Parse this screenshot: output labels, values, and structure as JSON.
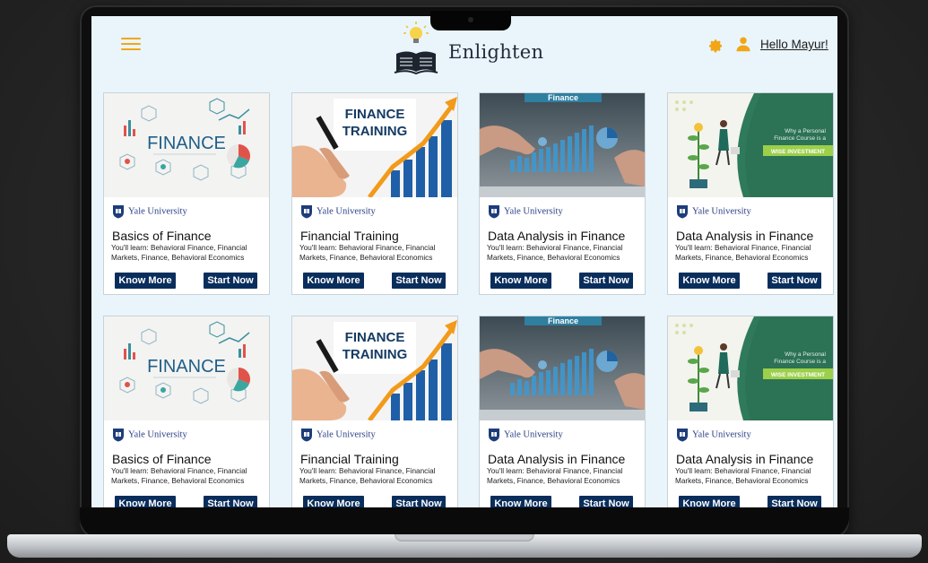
{
  "app": {
    "brand": "Enlighten",
    "greeting": "Hello Mayur!"
  },
  "thumbs": {
    "finance": {
      "word": "FINANCE"
    },
    "training": {
      "line1": "FINANCE",
      "line2": "TRAINING"
    },
    "data": {
      "tag": "Finance"
    },
    "invest": {
      "line1": "Why a Personal",
      "line2": "Finance Course is a",
      "banner": "WISE INVESTMENT"
    }
  },
  "courses": [
    {
      "thumb": "finance",
      "university": "Yale University",
      "title": "Basics of Finance",
      "learn": "You'll learn: Behavioral Finance, Financial Markets, Finance, Behavioral Economics",
      "know_more": "Know More",
      "start_now": "Start Now"
    },
    {
      "thumb": "training",
      "university": "Yale University",
      "title": "Financial Training",
      "learn": "You'll learn: Behavioral Finance, Financial Markets, Finance, Behavioral Economics",
      "know_more": "Know More",
      "start_now": "Start Now"
    },
    {
      "thumb": "data",
      "university": "Yale University",
      "title": "Data Analysis in Finance",
      "learn": "You'll learn: Behavioral Finance, Financial Markets, Finance, Behavioral Economics",
      "know_more": "Know More",
      "start_now": "Start Now"
    },
    {
      "thumb": "invest",
      "university": "Yale University",
      "title": "Data Analysis in Finance",
      "learn": "You'll learn: Behavioral Finance, Financial Markets, Finance, Behavioral Economics",
      "know_more": "Know More",
      "start_now": "Start Now"
    },
    {
      "thumb": "finance",
      "university": "Yale University",
      "title": "Basics of Finance",
      "learn": "You'll learn: Behavioral Finance, Financial Markets, Finance, Behavioral Economics",
      "know_more": "Know More",
      "start_now": "Start Now"
    },
    {
      "thumb": "training",
      "university": "Yale University",
      "title": "Financial Training",
      "learn": "You'll learn: Behavioral Finance, Financial Markets, Finance, Behavioral Economics",
      "know_more": "Know More",
      "start_now": "Start Now"
    },
    {
      "thumb": "data",
      "university": "Yale University",
      "title": "Data Analysis in Finance",
      "learn": "You'll learn: Behavioral Finance, Financial Markets, Finance, Behavioral Economics",
      "know_more": "Know More",
      "start_now": "Start Now"
    },
    {
      "thumb": "invest",
      "university": "Yale University",
      "title": "Data Analysis in Finance",
      "learn": "You'll learn: Behavioral Finance, Financial Markets, Finance, Behavioral Economics",
      "know_more": "Know More",
      "start_now": "Start Now"
    }
  ],
  "colors": {
    "accent": "#f2a516",
    "button": "#0a2e5c",
    "screen_bg": "#e9f5fb",
    "university_text": "#2c3f86"
  },
  "icons": [
    "hamburger-menu-icon",
    "bulb-book-logo-icon",
    "gear-icon",
    "user-icon",
    "university-crest-icon"
  ]
}
